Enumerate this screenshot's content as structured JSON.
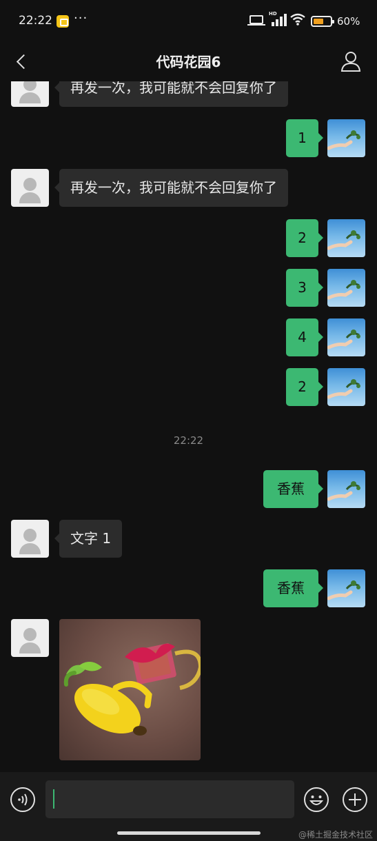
{
  "status_bar": {
    "time": "22:22",
    "dots": "···",
    "signal_hd": "HD",
    "battery_text": "60%",
    "battery_level": 0.6,
    "battery_color": "#f0a020"
  },
  "header": {
    "back_icon": "chevron-left-icon",
    "title": "代码花园6",
    "profile_icon": "person-icon"
  },
  "colors": {
    "background": "#111111",
    "bubble_sent": "#3cb872",
    "bubble_received": "#2c2c2c"
  },
  "messages": [
    {
      "side": "left",
      "text": "再发一次，我可能就不会回复你了"
    },
    {
      "side": "right",
      "text": "1"
    },
    {
      "side": "left",
      "text": "再发一次，我可能就不会回复你了"
    },
    {
      "side": "right",
      "text": "2"
    },
    {
      "side": "right",
      "text": "3"
    },
    {
      "side": "right",
      "text": "4"
    },
    {
      "side": "right",
      "text": "2"
    },
    {
      "type": "timestamp",
      "text": "22:22"
    },
    {
      "side": "right",
      "text": "香蕉"
    },
    {
      "side": "left",
      "text": "文字 1"
    },
    {
      "side": "right",
      "text": "香蕉"
    },
    {
      "side": "left",
      "type": "image",
      "image": "crocheted-banana-photo"
    }
  ],
  "input_bar": {
    "voice_icon": "voice-icon",
    "input_value": "",
    "emoji_icon": "emoji-icon",
    "plus_icon": "plus-icon"
  },
  "watermark": "@稀土掘金技术社区"
}
